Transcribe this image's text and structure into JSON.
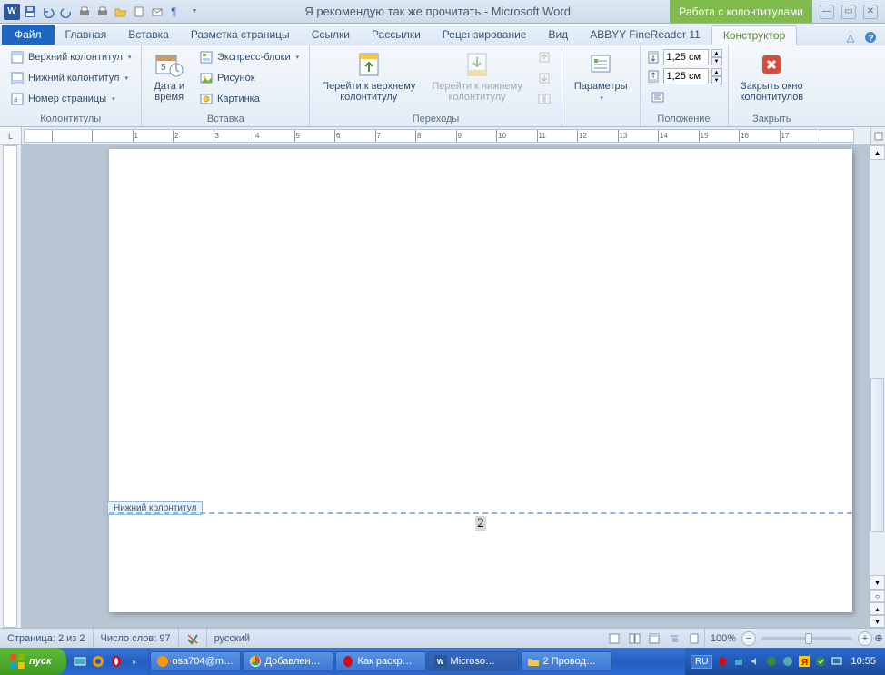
{
  "title": "Я рекомендую так же прочитать - Microsoft Word",
  "contextual_tab_group": "Работа с колонтитулами",
  "file_tab": "Файл",
  "tabs": [
    "Главная",
    "Вставка",
    "Разметка страницы",
    "Ссылки",
    "Рассылки",
    "Рецензирование",
    "Вид",
    "ABBYY FineReader 11"
  ],
  "active_tab": "Конструктор",
  "ribbon": {
    "g1": {
      "label": "Колонтитулы",
      "header": "Верхний колонтитул",
      "footer": "Нижний колонтитул",
      "pagenum": "Номер страницы"
    },
    "g2": {
      "label": "Вставка",
      "datetime_l1": "Дата и",
      "datetime_l2": "время",
      "quickparts": "Экспресс-блоки",
      "picture": "Рисунок",
      "clipart": "Картинка"
    },
    "g3": {
      "label": "Переходы",
      "goto_header_l1": "Перейти к верхнему",
      "goto_header_l2": "колонтитулу",
      "goto_footer_l1": "Перейти к нижнему",
      "goto_footer_l2": "колонтитулу"
    },
    "g4": {
      "label": "",
      "options_l1": "Параметры",
      "options_l2": ""
    },
    "g5": {
      "label": "Положение",
      "top": "1,25 см",
      "bottom": "1,25 см"
    },
    "g6": {
      "label": "Закрыть",
      "close_l1": "Закрыть окно",
      "close_l2": "колонтитулов"
    }
  },
  "footer_tab_label": "Нижний колонтитул",
  "page_number_display": "2",
  "status": {
    "page": "Страница: 2 из 2",
    "words": "Число слов: 97",
    "lang": "русский",
    "zoom": "100%"
  },
  "taskbar": {
    "start": "пуск",
    "tasks": [
      "osa704@m…",
      "Добавлен…",
      "Как раскр…",
      "Microso…",
      "2 Провод…"
    ],
    "lang": "RU",
    "clock": "10:55"
  }
}
